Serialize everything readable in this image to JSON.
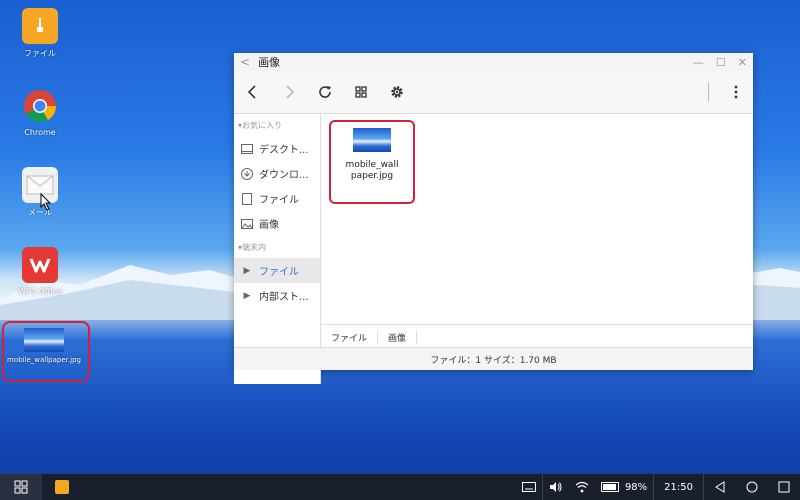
{
  "desktop": {
    "icons": [
      {
        "label": "ファイル"
      },
      {
        "label": "Chrome"
      },
      {
        "label": "メール"
      },
      {
        "label": "WPS Office"
      },
      {
        "label": "mobile_wallpaper.jpg"
      }
    ]
  },
  "window": {
    "title": "画像",
    "sidebar": {
      "section_favorites": "▾お気に入り",
      "section_device": "▾端末内",
      "items": [
        {
          "label": "デスクト..."
        },
        {
          "label": "ダウンロ..."
        },
        {
          "label": "ファイル"
        },
        {
          "label": "画像"
        },
        {
          "label": "ファイル"
        },
        {
          "label": "内部スト..."
        }
      ]
    },
    "file": {
      "name_line1": "mobile_wall",
      "name_line2": "paper.jpg"
    },
    "breadcrumb": [
      "ファイル",
      "画像"
    ],
    "status": "ファイル：1 サイズ：1.70 MB"
  },
  "taskbar": {
    "battery": "98%",
    "time": "21:50"
  },
  "colors": {
    "selection": "#d3223a",
    "accent": "#2a6fd6"
  }
}
